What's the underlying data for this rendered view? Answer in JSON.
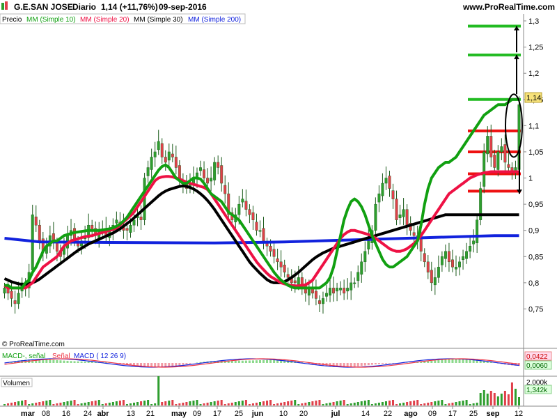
{
  "header": {
    "ticker": "G.E.SAN JOSE",
    "period": "Diario",
    "quote": "1,14 (+11,76%)",
    "date": "09-sep-2016",
    "site": "www.ProRealTime.com"
  },
  "legend": {
    "price": "Precio",
    "ma10": "MM (Simple 10)",
    "ma20": "MM (Simple 20)",
    "ma30": "MM (Simple 30)",
    "ma200": "MM (Simple 200)"
  },
  "watermark": "© ProRealTime.com",
  "macd_labels": {
    "macd_signal": "MACD-, señal",
    "signal": "Señal",
    "macd": "MACD ( 12 26 9)",
    "value1": "0,0422",
    "value2": "0,0060"
  },
  "volume_labels": {
    "title": "Volumen",
    "top": "2.000k",
    "value": "1,342k"
  },
  "current_price_label": "1,14",
  "colors": {
    "up": "#2e9e2e",
    "down": "#e0404a",
    "ma10": "#11a011",
    "ma20": "#ee1144",
    "ma30": "#000000",
    "ma200": "#1122dd",
    "resistance_green": "#22bb22",
    "support_red": "#ee1111"
  },
  "chart_data": {
    "type": "candlestick",
    "y_ticks": [
      "1,3",
      "1,25",
      "1,2",
      "1,15",
      "1,1",
      "1,05",
      "1",
      "0,95",
      "0,9",
      "0,85",
      "0,8",
      "0,75"
    ],
    "ylim": [
      0.715,
      1.3
    ],
    "x_ticks": [
      "mar",
      "08",
      "16",
      "24",
      "abr",
      "13",
      "21",
      "may",
      "09",
      "17",
      "25",
      "jun",
      "10",
      "20",
      "jul",
      "14",
      "22",
      "ago",
      "09",
      "17",
      "25",
      "sep",
      "12"
    ],
    "num_bars": 148,
    "closes": [
      0.79,
      0.78,
      0.77,
      0.76,
      0.78,
      0.8,
      0.79,
      0.82,
      0.93,
      0.91,
      0.88,
      0.86,
      0.87,
      0.89,
      0.88,
      0.86,
      0.85,
      0.87,
      0.89,
      0.9,
      0.88,
      0.87,
      0.88,
      0.89,
      0.91,
      0.9,
      0.89,
      0.9,
      0.9,
      0.89,
      0.9,
      0.91,
      0.92,
      0.91,
      0.9,
      0.9,
      0.91,
      0.92,
      0.93,
      0.92,
      1.0,
      1.02,
      1.04,
      1.05,
      1.07,
      1.04,
      1.03,
      1.05,
      1.04,
      1.02,
      1.0,
      0.99,
      0.98,
      0.99,
      1.0,
      1.01,
      1.02,
      1.0,
      0.99,
      1.0,
      1.03,
      1.02,
      0.99,
      0.97,
      0.93,
      0.92,
      0.93,
      0.95,
      0.96,
      0.94,
      0.93,
      0.92,
      0.9,
      0.9,
      0.88,
      0.87,
      0.86,
      0.85,
      0.84,
      0.83,
      0.82,
      0.81,
      0.8,
      0.8,
      0.81,
      0.79,
      0.78,
      0.79,
      0.78,
      0.77,
      0.76,
      0.77,
      0.78,
      0.79,
      0.78,
      0.79,
      0.79,
      0.78,
      0.79,
      0.8,
      0.8,
      0.82,
      0.84,
      0.86,
      0.88,
      0.9,
      0.95,
      0.97,
      0.99,
      1.0,
      0.98,
      0.96,
      0.92,
      0.93,
      0.94,
      0.91,
      0.9,
      0.89,
      0.88,
      0.86,
      0.84,
      0.82,
      0.8,
      0.81,
      0.83,
      0.85,
      0.86,
      0.84,
      0.83,
      0.83,
      0.84,
      0.85,
      0.86,
      0.87,
      0.88,
      0.92,
      0.98,
      1.05,
      1.08,
      1.04,
      1.02,
      1.05,
      1.06,
      1.03,
      1.02,
      1.01,
      1.02,
      1.14
    ],
    "ma10": [
      0.795,
      0.795,
      0.79,
      0.79,
      0.79,
      0.79,
      0.8,
      0.805,
      0.82,
      0.83,
      0.845,
      0.86,
      0.87,
      0.875,
      0.88,
      0.88,
      0.885,
      0.89,
      0.892,
      0.894,
      0.896,
      0.897,
      0.898,
      0.899,
      0.9,
      0.9,
      0.9,
      0.9,
      0.901,
      0.902,
      0.903,
      0.905,
      0.908,
      0.912,
      0.918,
      0.925,
      0.935,
      0.945,
      0.955,
      0.965,
      0.975,
      0.985,
      0.995,
      1.005,
      1.015,
      1.022,
      1.025,
      1.02,
      1.01,
      1.0,
      0.995,
      0.99,
      0.99,
      0.995,
      1.0,
      1.0,
      0.998,
      0.99,
      0.98,
      0.97,
      0.965,
      0.96,
      0.955,
      0.945,
      0.935,
      0.93,
      0.925,
      0.92,
      0.91,
      0.9,
      0.89,
      0.88,
      0.87,
      0.86,
      0.85,
      0.84,
      0.83,
      0.82,
      0.812,
      0.805,
      0.8,
      0.795,
      0.792,
      0.79,
      0.79,
      0.79,
      0.79,
      0.79,
      0.79,
      0.79,
      0.79,
      0.795,
      0.8,
      0.81,
      0.83,
      0.86,
      0.89,
      0.92,
      0.94,
      0.955,
      0.96,
      0.955,
      0.945,
      0.93,
      0.91,
      0.89,
      0.875,
      0.86,
      0.845,
      0.835,
      0.83,
      0.83,
      0.835,
      0.84,
      0.845,
      0.85,
      0.86,
      0.87,
      0.88,
      0.91,
      0.95,
      0.98,
      1.0,
      1.01,
      1.02,
      1.025,
      1.03,
      1.03,
      1.035,
      1.04,
      1.05,
      1.06,
      1.07,
      1.08,
      1.09,
      1.1,
      1.11,
      1.12,
      1.125,
      1.13,
      1.135,
      1.14,
      1.14,
      1.14,
      1.145,
      1.15,
      1.15,
      1.15
    ],
    "ma20": [
      0.795,
      0.79,
      0.79,
      0.79,
      0.79,
      0.79,
      0.79,
      0.795,
      0.8,
      0.81,
      0.82,
      0.83,
      0.835,
      0.84,
      0.845,
      0.85,
      0.86,
      0.87,
      0.875,
      0.88,
      0.882,
      0.884,
      0.886,
      0.888,
      0.889,
      0.89,
      0.892,
      0.894,
      0.896,
      0.898,
      0.9,
      0.902,
      0.905,
      0.91,
      0.916,
      0.922,
      0.928,
      0.935,
      0.945,
      0.955,
      0.965,
      0.975,
      0.985,
      0.995,
      1.0,
      1.002,
      1.003,
      1.003,
      1.002,
      1.0,
      0.998,
      0.995,
      0.992,
      0.99,
      0.988,
      0.986,
      0.984,
      0.982,
      0.978,
      0.97,
      0.96,
      0.95,
      0.94,
      0.93,
      0.92,
      0.91,
      0.9,
      0.89,
      0.88,
      0.87,
      0.86,
      0.85,
      0.84,
      0.832,
      0.825,
      0.818,
      0.812,
      0.808,
      0.804,
      0.8,
      0.798,
      0.796,
      0.795,
      0.794,
      0.794,
      0.795,
      0.796,
      0.8,
      0.805,
      0.815,
      0.825,
      0.835,
      0.845,
      0.855,
      0.865,
      0.875,
      0.885,
      0.892,
      0.897,
      0.9,
      0.9,
      0.898,
      0.896,
      0.894,
      0.892,
      0.89,
      0.885,
      0.88,
      0.875,
      0.87,
      0.865,
      0.862,
      0.86,
      0.86,
      0.862,
      0.865,
      0.87,
      0.875,
      0.882,
      0.89,
      0.9,
      0.91,
      0.92,
      0.93,
      0.94,
      0.95,
      0.96,
      0.97,
      0.975,
      0.98,
      0.985,
      0.99,
      0.995,
      1.0,
      1.003,
      1.006,
      1.008,
      1.01,
      1.011,
      1.012,
      1.012,
      1.012,
      1.012,
      1.012,
      1.012,
      1.012,
      1.012,
      1.012
    ],
    "ma30": [
      0.808,
      0.805,
      0.802,
      0.8,
      0.798,
      0.797,
      0.797,
      0.798,
      0.8,
      0.803,
      0.807,
      0.812,
      0.817,
      0.822,
      0.827,
      0.832,
      0.837,
      0.842,
      0.847,
      0.852,
      0.857,
      0.862,
      0.866,
      0.87,
      0.874,
      0.877,
      0.88,
      0.883,
      0.886,
      0.889,
      0.892,
      0.895,
      0.899,
      0.903,
      0.908,
      0.913,
      0.918,
      0.924,
      0.93,
      0.936,
      0.942,
      0.948,
      0.954,
      0.96,
      0.966,
      0.971,
      0.975,
      0.978,
      0.98,
      0.982,
      0.984,
      0.985,
      0.984,
      0.982,
      0.979,
      0.975,
      0.97,
      0.964,
      0.957,
      0.949,
      0.94,
      0.93,
      0.92,
      0.91,
      0.9,
      0.89,
      0.88,
      0.87,
      0.86,
      0.85,
      0.84,
      0.832,
      0.825,
      0.818,
      0.812,
      0.806,
      0.802,
      0.8,
      0.8,
      0.8,
      0.802,
      0.806,
      0.81,
      0.815,
      0.82,
      0.826,
      0.832,
      0.838,
      0.844,
      0.849,
      0.853,
      0.857,
      0.86,
      0.863,
      0.866,
      0.868,
      0.87,
      0.872,
      0.874,
      0.876,
      0.878,
      0.88,
      0.882,
      0.884,
      0.886,
      0.888,
      0.89,
      0.892,
      0.894,
      0.896,
      0.898,
      0.9,
      0.902,
      0.904,
      0.906,
      0.908,
      0.91,
      0.912,
      0.914,
      0.916,
      0.918,
      0.92,
      0.922,
      0.924,
      0.926,
      0.928,
      0.93,
      0.93,
      0.93,
      0.93,
      0.93,
      0.93,
      0.93,
      0.93,
      0.93,
      0.93,
      0.93,
      0.93,
      0.93,
      0.93,
      0.93,
      0.93,
      0.93,
      0.93,
      0.93,
      0.93,
      0.93,
      0.93
    ],
    "ma200_points": [
      [
        0,
        0.885
      ],
      [
        10,
        0.878
      ],
      [
        30,
        0.877
      ],
      [
        60,
        0.876
      ],
      [
        80,
        0.878
      ],
      [
        100,
        0.882
      ],
      [
        120,
        0.886
      ],
      [
        140,
        0.89
      ],
      [
        147,
        0.89
      ]
    ],
    "hlines": [
      {
        "price": 1.29,
        "color": "green",
        "x_start_frac": 0.84
      },
      {
        "price": 1.235,
        "color": "green",
        "x_start_frac": 0.84
      },
      {
        "price": 1.15,
        "color": "green",
        "x_start_frac": 0.84
      },
      {
        "price": 1.09,
        "color": "red",
        "x_start_frac": 0.84
      },
      {
        "price": 1.05,
        "color": "red",
        "x_start_frac": 0.84
      },
      {
        "price": 1.008,
        "color": "red",
        "x_start_frac": 0.84
      },
      {
        "price": 0.975,
        "color": "red",
        "x_start_frac": 0.84
      }
    ]
  }
}
